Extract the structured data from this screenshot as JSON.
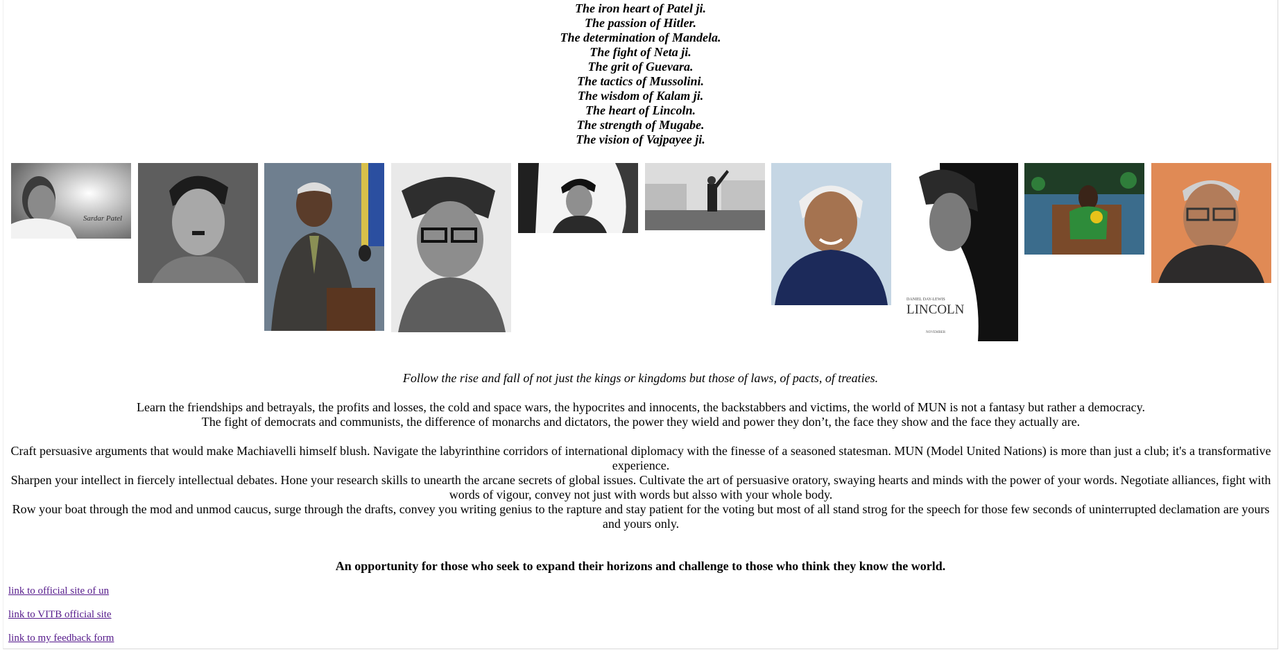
{
  "quotes": [
    "The iron heart of Patel ji.",
    "The passion of Hitler.",
    "The determination of Mandela.",
    "The fight of Neta ji.",
    "The grit of Guevara.",
    "The tactics of Mussolini.",
    "The wisdom of Kalam ji.",
    "The heart of Lincoln.",
    "The strength of Mugabe.",
    "The vision of Vajpayee ji."
  ],
  "photos": {
    "patel_caption": "Sardar Patel",
    "lincoln_poster_name": "LINCOLN",
    "lincoln_poster_credit": "DANIEL DAY-LEWIS",
    "lincoln_poster_date": "NOVEMBER"
  },
  "content": {
    "tagline": "Follow the rise and fall of not just the kings or kingdoms but those of laws, of pacts, of treaties.",
    "paragraph1_line1": "Learn the friendships and betrayals, the profits and losses, the cold and space wars, the hypocrites and innocents, the backstabbers and victims, the world of MUN is not a fantasy but rather a democracy.",
    "paragraph1_line2": "The fight of democrats and communists, the difference of monarchs and dictators, the power they wield and power they don’t, the face they show and the face they actually are.",
    "paragraph2_line1": "Craft persuasive arguments that would make Machiavelli himself blush. Navigate the labyrinthine corridors of international diplomacy with the finesse of a seasoned statesman. MUN (Model United Nations) is more than just a club; it's a transformative experience.",
    "paragraph2_line2": "Sharpen your intellect in fiercely intellectual debates. Hone your research skills to unearth the arcane secrets of global issues. Cultivate the art of persuasive oratory, swaying hearts and minds with the power of your words. Negotiate alliances, fight with words of vigour, convey not just with words but alsso with your whole body.",
    "paragraph2_line3": "Row your boat through the mod and unmod caucus, surge through the drafts, convey you writing genius to the rapture and stay patient for the voting but most of all stand strog for the speech for those few seconds of uninterrupted declamation are yours and yours only.",
    "emphasis": "An opportunity for those who seek to expand their horizons and challenge to those who think they know the world."
  },
  "links": {
    "un": "link to official site of un",
    "vitb": "link to VITB official site",
    "feedback": "link to my feedback form"
  },
  "colors": {
    "link_visited": "#551a8b",
    "page_background": "#ffffff"
  }
}
